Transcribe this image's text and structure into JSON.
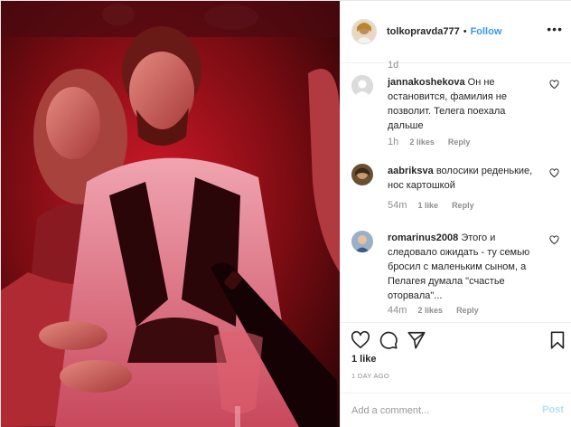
{
  "header": {
    "username": "tolkopravda777",
    "separator": "•",
    "follow_label": "Follow",
    "more_label": "•••"
  },
  "comments": {
    "top_time": "1d",
    "items": [
      {
        "username": "jannakoshekova",
        "text": "Он не остановится, фамилия не позволит. Телега поехала дальше",
        "time": "1h",
        "likes": "2 likes",
        "reply": "Reply"
      },
      {
        "username": "aabriksva",
        "text": "волосики реденькие, нос картошкой",
        "time": "54m",
        "likes": "1 like",
        "reply": "Reply"
      },
      {
        "username": "romarinus2008",
        "text": "Этого и следовало ожидать - ту семью бросил с маленьким сыном, а Пелагея думала \"счастье оторвала\"...",
        "time": "44m",
        "likes": "2 likes",
        "reply": "Reply"
      }
    ]
  },
  "footer": {
    "likes": "1 like",
    "posted": "1 DAY AGO",
    "comment_placeholder": "Add a comment...",
    "post_label": "Post"
  },
  "icons": [
    "heart-icon",
    "comment-icon",
    "share-icon",
    "bookmark-icon",
    "more-icon"
  ],
  "colors": {
    "accent": "#3897f0",
    "post_disabled": "#b2dffc",
    "meta": "#8e8e8e",
    "photo_tint": "#c0101a"
  }
}
